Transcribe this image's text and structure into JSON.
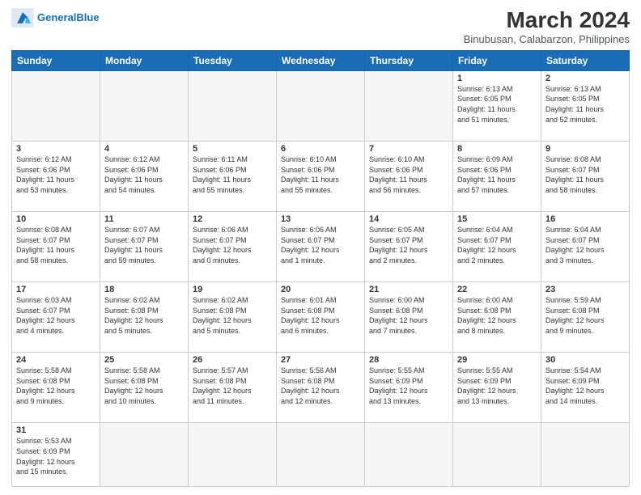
{
  "header": {
    "logo_general": "General",
    "logo_blue": "Blue",
    "title": "March 2024",
    "subtitle": "Binubusan, Calabarzon, Philippines"
  },
  "days_of_week": [
    "Sunday",
    "Monday",
    "Tuesday",
    "Wednesday",
    "Thursday",
    "Friday",
    "Saturday"
  ],
  "weeks": [
    [
      {
        "day": "",
        "info": ""
      },
      {
        "day": "",
        "info": ""
      },
      {
        "day": "",
        "info": ""
      },
      {
        "day": "",
        "info": ""
      },
      {
        "day": "",
        "info": ""
      },
      {
        "day": "1",
        "info": "Sunrise: 6:13 AM\nSunset: 6:05 PM\nDaylight: 11 hours\nand 51 minutes."
      },
      {
        "day": "2",
        "info": "Sunrise: 6:13 AM\nSunset: 6:05 PM\nDaylight: 11 hours\nand 52 minutes."
      }
    ],
    [
      {
        "day": "3",
        "info": "Sunrise: 6:12 AM\nSunset: 6:06 PM\nDaylight: 11 hours\nand 53 minutes."
      },
      {
        "day": "4",
        "info": "Sunrise: 6:12 AM\nSunset: 6:06 PM\nDaylight: 11 hours\nand 54 minutes."
      },
      {
        "day": "5",
        "info": "Sunrise: 6:11 AM\nSunset: 6:06 PM\nDaylight: 11 hours\nand 55 minutes."
      },
      {
        "day": "6",
        "info": "Sunrise: 6:10 AM\nSunset: 6:06 PM\nDaylight: 11 hours\nand 55 minutes."
      },
      {
        "day": "7",
        "info": "Sunrise: 6:10 AM\nSunset: 6:06 PM\nDaylight: 11 hours\nand 56 minutes."
      },
      {
        "day": "8",
        "info": "Sunrise: 6:09 AM\nSunset: 6:06 PM\nDaylight: 11 hours\nand 57 minutes."
      },
      {
        "day": "9",
        "info": "Sunrise: 6:08 AM\nSunset: 6:07 PM\nDaylight: 11 hours\nand 58 minutes."
      }
    ],
    [
      {
        "day": "10",
        "info": "Sunrise: 6:08 AM\nSunset: 6:07 PM\nDaylight: 11 hours\nand 58 minutes."
      },
      {
        "day": "11",
        "info": "Sunrise: 6:07 AM\nSunset: 6:07 PM\nDaylight: 11 hours\nand 59 minutes."
      },
      {
        "day": "12",
        "info": "Sunrise: 6:06 AM\nSunset: 6:07 PM\nDaylight: 12 hours\nand 0 minutes."
      },
      {
        "day": "13",
        "info": "Sunrise: 6:06 AM\nSunset: 6:07 PM\nDaylight: 12 hours\nand 1 minute."
      },
      {
        "day": "14",
        "info": "Sunrise: 6:05 AM\nSunset: 6:07 PM\nDaylight: 12 hours\nand 2 minutes."
      },
      {
        "day": "15",
        "info": "Sunrise: 6:04 AM\nSunset: 6:07 PM\nDaylight: 12 hours\nand 2 minutes."
      },
      {
        "day": "16",
        "info": "Sunrise: 6:04 AM\nSunset: 6:07 PM\nDaylight: 12 hours\nand 3 minutes."
      }
    ],
    [
      {
        "day": "17",
        "info": "Sunrise: 6:03 AM\nSunset: 6:07 PM\nDaylight: 12 hours\nand 4 minutes."
      },
      {
        "day": "18",
        "info": "Sunrise: 6:02 AM\nSunset: 6:08 PM\nDaylight: 12 hours\nand 5 minutes."
      },
      {
        "day": "19",
        "info": "Sunrise: 6:02 AM\nSunset: 6:08 PM\nDaylight: 12 hours\nand 5 minutes."
      },
      {
        "day": "20",
        "info": "Sunrise: 6:01 AM\nSunset: 6:08 PM\nDaylight: 12 hours\nand 6 minutes."
      },
      {
        "day": "21",
        "info": "Sunrise: 6:00 AM\nSunset: 6:08 PM\nDaylight: 12 hours\nand 7 minutes."
      },
      {
        "day": "22",
        "info": "Sunrise: 6:00 AM\nSunset: 6:08 PM\nDaylight: 12 hours\nand 8 minutes."
      },
      {
        "day": "23",
        "info": "Sunrise: 5:59 AM\nSunset: 6:08 PM\nDaylight: 12 hours\nand 9 minutes."
      }
    ],
    [
      {
        "day": "24",
        "info": "Sunrise: 5:58 AM\nSunset: 6:08 PM\nDaylight: 12 hours\nand 9 minutes."
      },
      {
        "day": "25",
        "info": "Sunrise: 5:58 AM\nSunset: 6:08 PM\nDaylight: 12 hours\nand 10 minutes."
      },
      {
        "day": "26",
        "info": "Sunrise: 5:57 AM\nSunset: 6:08 PM\nDaylight: 12 hours\nand 11 minutes."
      },
      {
        "day": "27",
        "info": "Sunrise: 5:56 AM\nSunset: 6:08 PM\nDaylight: 12 hours\nand 12 minutes."
      },
      {
        "day": "28",
        "info": "Sunrise: 5:55 AM\nSunset: 6:09 PM\nDaylight: 12 hours\nand 13 minutes."
      },
      {
        "day": "29",
        "info": "Sunrise: 5:55 AM\nSunset: 6:09 PM\nDaylight: 12 hours\nand 13 minutes."
      },
      {
        "day": "30",
        "info": "Sunrise: 5:54 AM\nSunset: 6:09 PM\nDaylight: 12 hours\nand 14 minutes."
      }
    ],
    [
      {
        "day": "31",
        "info": "Sunrise: 5:53 AM\nSunset: 6:09 PM\nDaylight: 12 hours\nand 15 minutes."
      },
      {
        "day": "",
        "info": ""
      },
      {
        "day": "",
        "info": ""
      },
      {
        "day": "",
        "info": ""
      },
      {
        "day": "",
        "info": ""
      },
      {
        "day": "",
        "info": ""
      },
      {
        "day": "",
        "info": ""
      }
    ]
  ]
}
